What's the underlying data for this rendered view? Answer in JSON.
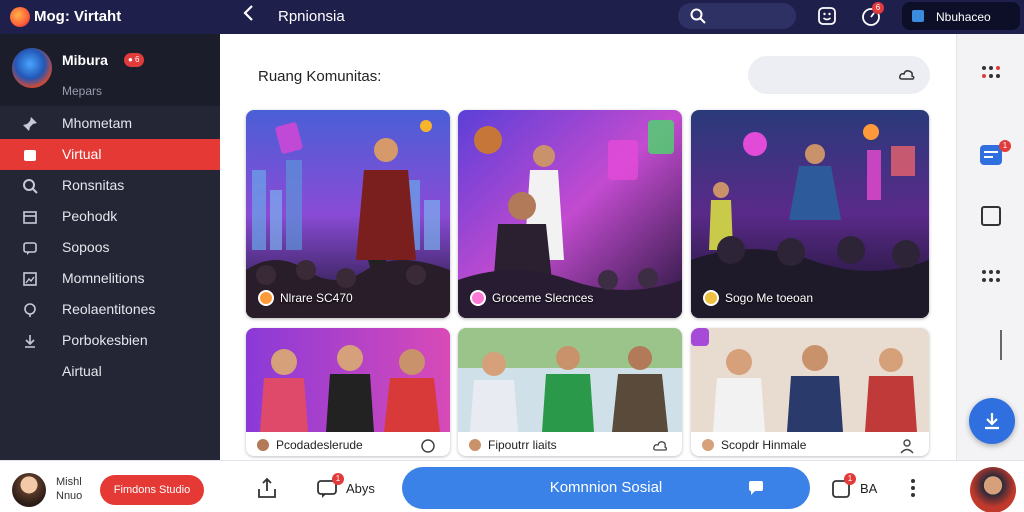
{
  "topbar": {
    "app_title": "Mog: Virtaht",
    "page_title": "Rpnionsia",
    "notification_count": "6",
    "button_label": "Nbuhaceo"
  },
  "sidebar": {
    "profile": {
      "name": "Mibura",
      "badge": "● 6",
      "subtitle": "Mepars"
    },
    "items": [
      {
        "label": "Mhometam",
        "icon": "pin-icon"
      },
      {
        "label": "Virtual",
        "icon": "folder-icon",
        "active": true
      },
      {
        "label": "Ronsnitas",
        "icon": "search-icon"
      },
      {
        "label": "Peohodk",
        "icon": "calendar-icon"
      },
      {
        "label": "Sopoos",
        "icon": "chat-icon"
      },
      {
        "label": "Momnelitions",
        "icon": "image-icon"
      },
      {
        "label": "Reolaentitones",
        "icon": "location-icon"
      },
      {
        "label": "Porbokesbien",
        "icon": "download-icon"
      },
      {
        "label": "Airtual",
        "icon": ""
      }
    ]
  },
  "main": {
    "title": "Ruang Komunitas:",
    "cards": [
      {
        "caption": "Nlrare SC470"
      },
      {
        "caption": "Groceme Slecnces"
      },
      {
        "caption": "Sogo Me toeoan"
      }
    ],
    "lower_cards": [
      {
        "caption": "Pcodadeslerude"
      },
      {
        "caption": "Fipoutrr liaits"
      },
      {
        "caption": "Scopdr Hinmale"
      }
    ]
  },
  "bottombar": {
    "user_name": "Mishl Nnuo",
    "studio_button": "Fimdons Studio",
    "apps_label": "Abys",
    "social_button": "Komnnion Sosial",
    "ba_label": "BA"
  },
  "rail": {
    "badge": "1"
  },
  "colors": {
    "accent": "#e53935",
    "topbar": "#1e1f4a",
    "primary_blue": "#3b82e8"
  }
}
